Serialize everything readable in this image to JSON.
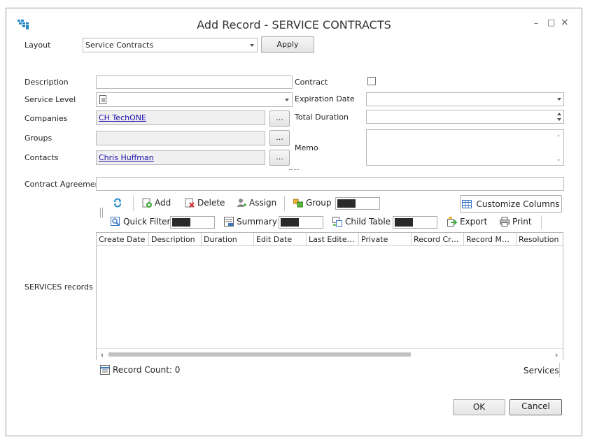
{
  "window": {
    "title": "Add Record - SERVICE  CONTRACTS",
    "controls": {
      "minimize": "–",
      "maximize": "□",
      "close": "×"
    }
  },
  "layout_row": {
    "label": "Layout",
    "value": "Service Contracts",
    "apply_label": "Apply"
  },
  "form": {
    "description_label": "Description",
    "service_level_label": "Service Level",
    "companies_label": "Companies",
    "companies_value": "CH TechONE",
    "groups_label": "Groups",
    "contacts_label": "Contacts",
    "contacts_value": "Chris Huffman",
    "contract_label": "Contract",
    "expiration_date_label": "Expiration Date",
    "total_duration_label": "Total Duration",
    "memo_label": "Memo",
    "contract_agreement_label": "Contract Agreement",
    "ellipsis": "..."
  },
  "toolbar": {
    "add": "Add",
    "delete": "Delete",
    "assign": "Assign",
    "group": "Group",
    "customize_columns": "Customize Columns",
    "quick_filter": "Quick Filter",
    "summary": "Summary",
    "child_table": "Child Table",
    "export": "Export",
    "print": "Print"
  },
  "services": {
    "label": "SERVICES records",
    "columns": [
      "Create Date",
      "Description",
      "Duration",
      "Edit Date",
      "Last Edited...",
      "Private",
      "Record Cre...",
      "Record Ma...",
      "Resolution"
    ],
    "record_count": "Record Count: 0",
    "footer_right": "Services"
  },
  "footer": {
    "ok_label": "OK",
    "cancel_label": "Cancel"
  },
  "icons": {
    "app": "grid-app-icon",
    "refresh": "refresh-icon",
    "add": "add-icon",
    "delete": "delete-icon",
    "assign": "assign-icon",
    "group": "group-icon",
    "customize": "columns-icon",
    "quick_filter": "filter-icon",
    "summary": "summary-icon",
    "child_table": "child-table-icon",
    "export": "export-icon",
    "print": "print-icon"
  },
  "colors": {
    "link": "#1a0dab",
    "accent_blue": "#1e88c8",
    "swatch": "#2a2a2a"
  }
}
